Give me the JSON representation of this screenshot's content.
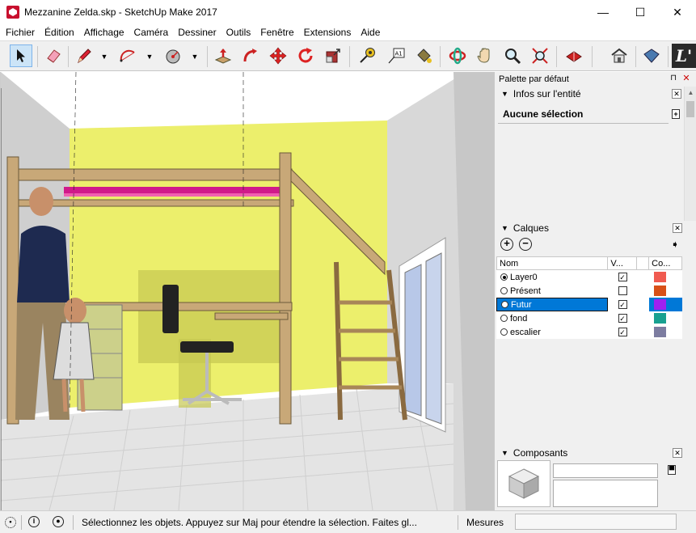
{
  "window": {
    "title": "Mezzanine Zelda.skp - SketchUp Make 2017",
    "minimize": "—",
    "maximize": "☐",
    "close": "✕"
  },
  "menu": [
    "Fichier",
    "Édition",
    "Affichage",
    "Caméra",
    "Dessiner",
    "Outils",
    "Fenêtre",
    "Extensions",
    "Aide"
  ],
  "toolbar": {
    "logo_glyph": "L'",
    "tools": [
      {
        "name": "select-tool-icon"
      },
      {
        "name": "eraser-tool-icon"
      },
      {
        "name": "pencil-tool-icon"
      },
      {
        "name": "arc-tool-icon"
      },
      {
        "name": "shape-tool-icon"
      },
      {
        "name": "push-pull-tool-icon"
      },
      {
        "name": "follow-me-tool-icon"
      },
      {
        "name": "move-tool-icon"
      },
      {
        "name": "rotate-tool-icon"
      },
      {
        "name": "scale-tool-icon"
      },
      {
        "name": "tape-measure-tool-icon"
      },
      {
        "name": "text-tool-icon"
      },
      {
        "name": "paint-bucket-tool-icon"
      },
      {
        "name": "orbit-tool-icon"
      },
      {
        "name": "pan-tool-icon"
      },
      {
        "name": "zoom-tool-icon"
      },
      {
        "name": "zoom-extents-tool-icon"
      },
      {
        "name": "warehouse-tool-icon"
      },
      {
        "name": "extension-warehouse-icon"
      },
      {
        "name": "send-to-layout-icon"
      }
    ]
  },
  "tray": {
    "title": "Palette par défaut",
    "pin": "⊓",
    "close": "✕",
    "entity_info": {
      "title": "Infos sur l'entité",
      "selection": "Aucune sélection",
      "toggle": "+"
    },
    "layers": {
      "title": "Calques",
      "add": "+",
      "remove": "−",
      "details": "➧",
      "columns": {
        "name": "Nom",
        "visible": "V...",
        "color": "Co..."
      },
      "rows": [
        {
          "name": "Layer0",
          "active": true,
          "visible": true,
          "color": "#f05a50",
          "selected": false
        },
        {
          "name": "Présent",
          "active": false,
          "visible": false,
          "color": "#d85018",
          "selected": false
        },
        {
          "name": "Futur",
          "active": false,
          "visible": true,
          "color": "#a020f0",
          "selected": true
        },
        {
          "name": "fond",
          "active": false,
          "visible": true,
          "color": "#18a090",
          "selected": false
        },
        {
          "name": "escalier",
          "active": false,
          "visible": true,
          "color": "#7c7ca0",
          "selected": false
        }
      ]
    },
    "components": {
      "title": "Composants"
    }
  },
  "status": {
    "message": "Sélectionnez les objets. Appuyez sur Maj pour étendre la sélection. Faites gl...",
    "measure_label": "Mesures",
    "measure_value": ""
  }
}
